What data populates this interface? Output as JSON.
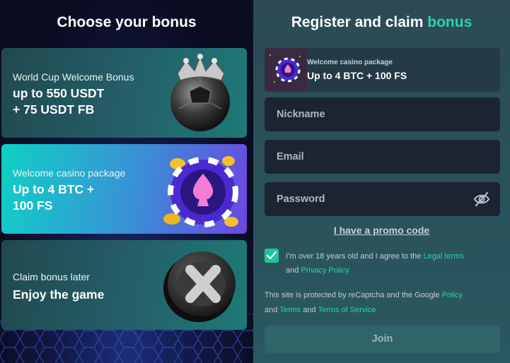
{
  "left": {
    "title": "Choose your bonus",
    "cards": [
      {
        "subtitle": "World Cup Welcome Bonus",
        "headline_1": "up to 550 USDT",
        "headline_2": "+ 75 USDT FB",
        "icon": "crowned-soccer-ball-icon"
      },
      {
        "subtitle": "Welcome casino package",
        "headline_1": "Up to 4 BTC +",
        "headline_2": "100 FS",
        "icon": "casino-chip-icon"
      },
      {
        "subtitle": "Claim bonus later",
        "headline_1": "Enjoy the game",
        "headline_2": "",
        "icon": "close-x-coin-icon"
      }
    ]
  },
  "right": {
    "title_main": "Register and claim",
    "title_accent": "bonus",
    "selected_bonus": {
      "label": "Welcome casino package",
      "value": "Up to 4 BTC + 100 FS"
    },
    "fields": {
      "nickname_placeholder": "Nickname",
      "email_placeholder": "Email",
      "password_placeholder": "Password"
    },
    "promo_link": "I have a promo code",
    "agree": {
      "prefix": "I’m over 18 years old and I agree to the",
      "legal_link": "Legal terms",
      "and": "and",
      "privacy_link": "Privacy Policy",
      "checked": true
    },
    "recaptcha": {
      "prefix": "This site is protected by reCaptcha and the Google",
      "policy_link": "Policy",
      "and1": "and",
      "terms_link": "Terms",
      "and2": "and",
      "tos_link": "Terms of Service"
    },
    "join_label": "Join"
  },
  "colors": {
    "accent": "#2ed3a8",
    "left_bg": "#0d0f26",
    "right_bg": "#2b4a55",
    "field_bg": "#1b2430"
  }
}
